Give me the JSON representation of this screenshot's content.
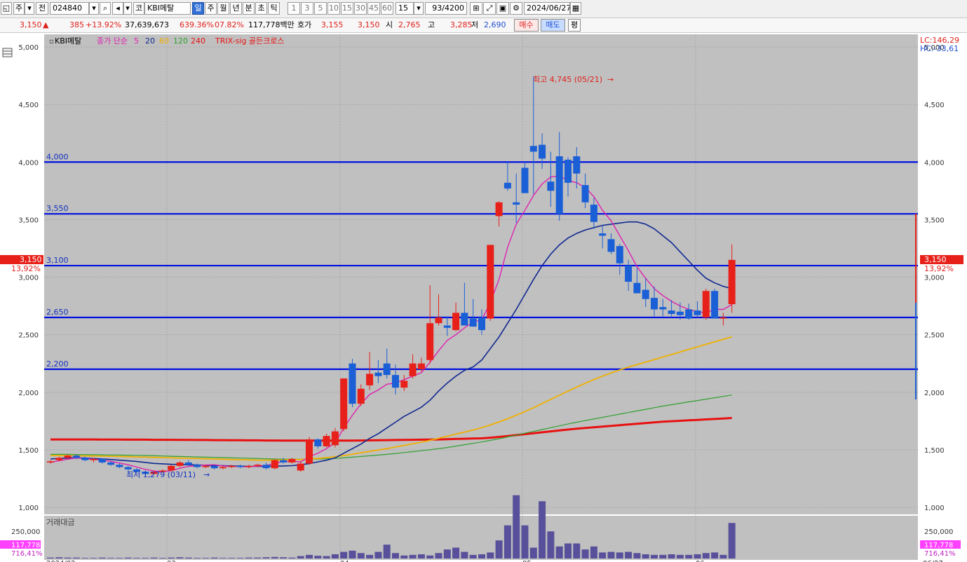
{
  "toolbar": {
    "mode1": "주",
    "mode2": "전",
    "code": "024840",
    "market": "코",
    "name": "KBI메탈",
    "periods": [
      "일",
      "주",
      "월",
      "년",
      "분",
      "초",
      "틱"
    ],
    "minutes": [
      "1",
      "3",
      "5",
      "10",
      "15",
      "30",
      "45",
      "60"
    ],
    "n": "15",
    "count": "93/4200",
    "date": "2024/06/27"
  },
  "quote": {
    "price": "3,150",
    "arrow": "▲",
    "change": "385",
    "change_pct": "+13.92%",
    "volume": "37,639,673",
    "vol_ratio": "639.36%",
    "turnover": "07.82%",
    "amount": "117,778백만",
    "ask_label": "호가",
    "ask1": "3,155",
    "ask2": "3,150",
    "open_label": "시",
    "open": "2,765",
    "high_label": "고",
    "high": "3,285",
    "low_label": "저",
    "low": "2,690",
    "buy_label": "매수",
    "sell_label": "매도",
    "flat_label": "평"
  },
  "legend": {
    "name": "KBI메탈",
    "ma_label": "종가 단순",
    "ma5": "5",
    "ma20": "20",
    "ma60": "60",
    "ma120": "120",
    "ma240": "240",
    "trix": "TRIX-sig 골든크로스"
  },
  "right_info": {
    "lc": "LC:146,29",
    "hc": "HC:-33,61"
  },
  "current": {
    "price": "3,150",
    "pct": "13,92%"
  },
  "volume_panel": {
    "title": "거래대금",
    "tick": "250,000",
    "value": "117,778",
    "pct": "716,41%"
  },
  "annotations": {
    "high": "최고 4,745 (05/21)",
    "low": "최저 1,279 (03/11)"
  },
  "colors": {
    "up": "#e8201a",
    "down": "#1a5fd6",
    "ma5": "#e020b0",
    "ma20": "#102890",
    "ma60": "#f0b000",
    "ma120": "#30a030",
    "ma240": "#e81010",
    "level": "#0010e0"
  },
  "chart_data": {
    "type": "candlestick",
    "y_ticks": [
      "1,000",
      "1,500",
      "2,000",
      "2,500",
      "3,000",
      "3,500",
      "4,000",
      "4,500",
      "5,000"
    ],
    "ylim": [
      1000,
      5000
    ],
    "x_labels": [
      "2024/02",
      "03",
      "04",
      "05",
      "06",
      "06/27"
    ],
    "levels": [
      {
        "label": "4,000",
        "value": 4000
      },
      {
        "label": "3,550",
        "value": 3550
      },
      {
        "label": "3,100",
        "value": 3100
      },
      {
        "label": "2,650",
        "value": 2650
      },
      {
        "label": "2,200",
        "value": 2200
      }
    ],
    "candles": [
      [
        1390,
        1410,
        1380,
        1400
      ],
      [
        1410,
        1440,
        1400,
        1430
      ],
      [
        1430,
        1460,
        1420,
        1450
      ],
      [
        1450,
        1460,
        1420,
        1430
      ],
      [
        1430,
        1440,
        1400,
        1410
      ],
      [
        1410,
        1430,
        1390,
        1420
      ],
      [
        1420,
        1425,
        1380,
        1390
      ],
      [
        1390,
        1400,
        1360,
        1370
      ],
      [
        1370,
        1380,
        1340,
        1350
      ],
      [
        1350,
        1360,
        1320,
        1330
      ],
      [
        1330,
        1340,
        1300,
        1310
      ],
      [
        1310,
        1320,
        1279,
        1290
      ],
      [
        1290,
        1320,
        1285,
        1310
      ],
      [
        1310,
        1330,
        1300,
        1320
      ],
      [
        1320,
        1370,
        1310,
        1360
      ],
      [
        1360,
        1400,
        1350,
        1390
      ],
      [
        1390,
        1410,
        1360,
        1370
      ],
      [
        1370,
        1380,
        1340,
        1350
      ],
      [
        1350,
        1370,
        1340,
        1360
      ],
      [
        1360,
        1370,
        1330,
        1340
      ],
      [
        1340,
        1360,
        1330,
        1350
      ],
      [
        1350,
        1370,
        1340,
        1360
      ],
      [
        1360,
        1370,
        1340,
        1350
      ],
      [
        1350,
        1370,
        1340,
        1360
      ],
      [
        1360,
        1380,
        1350,
        1370
      ],
      [
        1370,
        1390,
        1330,
        1340
      ],
      [
        1340,
        1420,
        1330,
        1410
      ],
      [
        1410,
        1430,
        1380,
        1390
      ],
      [
        1390,
        1430,
        1380,
        1420
      ],
      [
        1320,
        1400,
        1310,
        1380
      ],
      [
        1380,
        1610,
        1370,
        1590
      ],
      [
        1590,
        1600,
        1510,
        1530
      ],
      [
        1530,
        1640,
        1520,
        1620
      ],
      [
        1540,
        1690,
        1520,
        1660
      ],
      [
        1680,
        1940,
        1660,
        2120
      ],
      [
        2250,
        2290,
        1870,
        1900
      ],
      [
        1900,
        2070,
        1880,
        2030
      ],
      [
        2060,
        2350,
        2020,
        2160
      ],
      [
        2170,
        2280,
        2080,
        2140
      ],
      [
        2250,
        2380,
        2120,
        2150
      ],
      [
        2150,
        2240,
        1980,
        2040
      ],
      [
        2040,
        2150,
        2010,
        2100
      ],
      [
        2140,
        2330,
        2120,
        2250
      ],
      [
        2200,
        2300,
        2180,
        2250
      ],
      [
        2280,
        2930,
        2250,
        2600
      ],
      [
        2600,
        2850,
        2580,
        2650
      ],
      [
        2580,
        2660,
        2490,
        2560
      ],
      [
        2540,
        2780,
        2530,
        2690
      ],
      [
        2690,
        2950,
        2620,
        2580
      ],
      [
        2640,
        2810,
        2600,
        2570
      ],
      [
        2650,
        2720,
        2500,
        2540
      ],
      [
        2640,
        3280,
        2620,
        3280
      ],
      [
        3530,
        3660,
        3440,
        3650
      ],
      [
        3820,
        4000,
        3750,
        3770
      ],
      [
        3650,
        3900,
        3470,
        3630
      ],
      [
        3950,
        4000,
        3740,
        3730
      ],
      [
        4140,
        4745,
        3720,
        4090
      ],
      [
        4150,
        4250,
        3940,
        4030
      ],
      [
        3830,
        4090,
        3610,
        3750
      ],
      [
        4050,
        4260,
        3490,
        3550
      ],
      [
        4020,
        4040,
        3700,
        3820
      ],
      [
        4050,
        4130,
        3770,
        3900
      ],
      [
        3800,
        3900,
        3600,
        3650
      ],
      [
        3630,
        3690,
        3420,
        3480
      ],
      [
        3380,
        3450,
        3250,
        3360
      ],
      [
        3330,
        3380,
        3200,
        3220
      ],
      [
        3270,
        3290,
        3020,
        3120
      ],
      [
        3100,
        3150,
        2880,
        2960
      ],
      [
        2950,
        3080,
        2860,
        2860
      ],
      [
        2890,
        2990,
        2740,
        2810
      ],
      [
        2820,
        2920,
        2660,
        2720
      ],
      [
        2740,
        2810,
        2660,
        2720
      ],
      [
        2710,
        2800,
        2650,
        2680
      ],
      [
        2700,
        2780,
        2630,
        2670
      ],
      [
        2720,
        2770,
        2630,
        2640
      ],
      [
        2710,
        2790,
        2650,
        2670
      ],
      [
        2650,
        2900,
        2630,
        2880
      ],
      [
        2880,
        2900,
        2670,
        2640
      ],
      [
        2640,
        2690,
        2580,
        2650
      ],
      [
        2765,
        3285,
        2690,
        3150
      ]
    ],
    "ma5": [
      1390,
      1405,
      1418,
      1430,
      1424,
      1418,
      1410,
      1400,
      1385,
      1370,
      1350,
      1330,
      1316,
      1308,
      1320,
      1340,
      1356,
      1362,
      1368,
      1370,
      1360,
      1356,
      1354,
      1352,
      1358,
      1364,
      1382,
      1398,
      1400,
      1395,
      1440,
      1470,
      1510,
      1560,
      1690,
      1800,
      1900,
      1980,
      2020,
      2070,
      2080,
      2110,
      2140,
      2170,
      2260,
      2360,
      2450,
      2500,
      2560,
      2610,
      2630,
      2780,
      2980,
      3260,
      3460,
      3580,
      3710,
      3810,
      3870,
      3880,
      3840,
      3820,
      3780,
      3700,
      3580,
      3490,
      3360,
      3230,
      3090,
      2990,
      2900,
      2840,
      2790,
      2750,
      2720,
      2700,
      2690,
      2720,
      2720,
      2760
    ],
    "ma20": [
      1420,
      1425,
      1428,
      1430,
      1428,
      1424,
      1420,
      1416,
      1410,
      1404,
      1398,
      1390,
      1382,
      1378,
      1374,
      1372,
      1370,
      1368,
      1366,
      1364,
      1362,
      1360,
      1358,
      1356,
      1356,
      1356,
      1358,
      1360,
      1362,
      1370,
      1380,
      1395,
      1410,
      1430,
      1470,
      1510,
      1550,
      1600,
      1640,
      1690,
      1740,
      1790,
      1830,
      1870,
      1930,
      2010,
      2080,
      2140,
      2190,
      2220,
      2280,
      2380,
      2480,
      2600,
      2720,
      2850,
      2980,
      3100,
      3200,
      3280,
      3340,
      3380,
      3410,
      3430,
      3450,
      3460,
      3470,
      3480,
      3480,
      3460,
      3420,
      3360,
      3300,
      3220,
      3140,
      3060,
      2990,
      2950,
      2920,
      2900
    ],
    "ma60": [
      1450,
      1450,
      1449,
      1448,
      1447,
      1446,
      1445,
      1444,
      1442,
      1440,
      1438,
      1436,
      1434,
      1432,
      1430,
      1428,
      1426,
      1424,
      1422,
      1420,
      1418,
      1416,
      1414,
      1412,
      1410,
      1410,
      1410,
      1412,
      1414,
      1416,
      1420,
      1425,
      1432,
      1440,
      1450,
      1462,
      1474,
      1486,
      1498,
      1510,
      1524,
      1538,
      1552,
      1566,
      1582,
      1600,
      1618,
      1636,
      1654,
      1672,
      1692,
      1716,
      1742,
      1770,
      1800,
      1832,
      1866,
      1902,
      1938,
      1974,
      2010,
      2044,
      2078,
      2110,
      2140,
      2168,
      2194,
      2218,
      2240,
      2262,
      2284,
      2306,
      2328,
      2350,
      2372,
      2394,
      2416,
      2438,
      2460,
      2482
    ],
    "ma120": [
      1460,
      1460,
      1460,
      1459,
      1458,
      1457,
      1456,
      1455,
      1454,
      1453,
      1452,
      1450,
      1448,
      1446,
      1444,
      1442,
      1440,
      1438,
      1436,
      1434,
      1432,
      1430,
      1428,
      1426,
      1424,
      1422,
      1420,
      1419,
      1418,
      1418,
      1418,
      1420,
      1422,
      1425,
      1430,
      1436,
      1442,
      1448,
      1454,
      1460,
      1468,
      1476,
      1484,
      1492,
      1500,
      1510,
      1520,
      1532,
      1544,
      1556,
      1568,
      1582,
      1596,
      1612,
      1628,
      1644,
      1660,
      1676,
      1692,
      1708,
      1724,
      1740,
      1754,
      1768,
      1782,
      1796,
      1810,
      1824,
      1838,
      1852,
      1866,
      1880,
      1892,
      1904,
      1916,
      1928,
      1940,
      1952,
      1964,
      1976
    ],
    "ma240": [
      1590,
      1590,
      1590,
      1590,
      1590,
      1590,
      1589,
      1589,
      1589,
      1588,
      1588,
      1588,
      1587,
      1587,
      1587,
      1586,
      1586,
      1585,
      1585,
      1584,
      1584,
      1583,
      1583,
      1582,
      1582,
      1581,
      1581,
      1580,
      1580,
      1580,
      1580,
      1580,
      1580,
      1580,
      1580,
      1580,
      1581,
      1582,
      1583,
      1584,
      1585,
      1586,
      1587,
      1588,
      1589,
      1590,
      1592,
      1594,
      1596,
      1598,
      1600,
      1605,
      1612,
      1620,
      1628,
      1636,
      1644,
      1652,
      1660,
      1668,
      1676,
      1684,
      1690,
      1696,
      1702,
      1708,
      1714,
      1720,
      1726,
      1732,
      1738,
      1744,
      1748,
      1752,
      1756,
      1760,
      1764,
      1768,
      1772,
      1776
    ],
    "turnover": [
      3,
      4,
      3,
      3,
      2,
      2,
      3,
      2,
      2,
      3,
      2,
      2,
      3,
      2,
      3,
      4,
      3,
      2,
      2,
      3,
      2,
      2,
      2,
      3,
      3,
      4,
      5,
      4,
      3,
      8,
      12,
      9,
      8,
      14,
      22,
      26,
      18,
      12,
      22,
      46,
      18,
      10,
      12,
      14,
      10,
      18,
      30,
      36,
      22,
      12,
      14,
      20,
      60,
      110,
      210,
      110,
      36,
      190,
      90,
      40,
      50,
      50,
      30,
      40,
      20,
      22,
      20,
      22,
      18,
      14,
      12,
      12,
      14,
      12,
      12,
      14,
      18,
      20,
      12,
      118
    ]
  }
}
